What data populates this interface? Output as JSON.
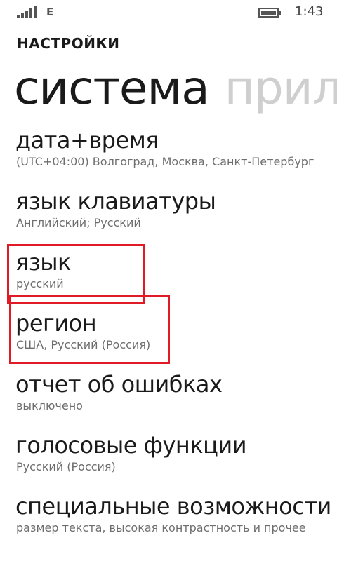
{
  "status_bar": {
    "network_type": "E",
    "time": "1:43",
    "signal_icon": "signal-strength-icon",
    "battery_icon": "battery-icon"
  },
  "header": {
    "app_title": "НАСТРОЙКИ",
    "pivot_active": "система",
    "pivot_next": "прилож"
  },
  "settings": [
    {
      "title": "дата+время",
      "subtitle": "(UTC+04:00) Волгоград, Москва, Санкт-Петербург"
    },
    {
      "title": "язык клавиатуры",
      "subtitle": "Английский; Русский"
    },
    {
      "title": "язык",
      "subtitle": "русский"
    },
    {
      "title": "регион",
      "subtitle": "США, Русский (Россия)"
    },
    {
      "title": "отчет об ошибках",
      "subtitle": "выключено"
    },
    {
      "title": "голосовые функции",
      "subtitle": "Русский (Россия)"
    },
    {
      "title": "специальные возможности",
      "subtitle": "размер текста, высокая контрастность и прочее"
    }
  ],
  "colors": {
    "highlight": "#e01b26",
    "pivot_inactive": "#cfcfcf",
    "subtitle": "#6e6e6e"
  }
}
